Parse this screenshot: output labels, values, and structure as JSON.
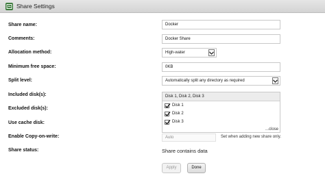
{
  "window": {
    "title": "Share Settings",
    "icon": "share-settings-icon"
  },
  "form": {
    "share_name": {
      "label": "Share name:",
      "value": "Docker"
    },
    "comments": {
      "label": "Comments:",
      "value": "Docker Share"
    },
    "allocation_method": {
      "label": "Allocation method:",
      "value": "High-water"
    },
    "minimum_free_space": {
      "label": "Minimum free space:",
      "value": "0KB"
    },
    "split_level": {
      "label": "Split level:",
      "value": "Automatically split any directory as required"
    },
    "included_disks": {
      "label": "Included disk(s):",
      "summary": "Disk 1, Disk 2, Disk 3",
      "options": [
        {
          "label": "Disk 1",
          "checked": true
        },
        {
          "label": "Disk 2",
          "checked": true
        },
        {
          "label": "Disk 3",
          "checked": true
        }
      ],
      "close_label": "...close"
    },
    "excluded_disks": {
      "label": "Excluded disk(s):"
    },
    "use_cache_disk": {
      "label": "Use cache disk:"
    },
    "copy_on_write": {
      "label": "Enable Copy-on-write:",
      "value": "Auto",
      "note": "Set when adding new share only."
    },
    "share_status": {
      "label": "Share status:",
      "value": "Share contains data"
    }
  },
  "buttons": {
    "apply": "Apply",
    "done": "Done"
  },
  "colors": {
    "titlebar": "#d9d9d9",
    "icon": "#3b7a3b"
  }
}
